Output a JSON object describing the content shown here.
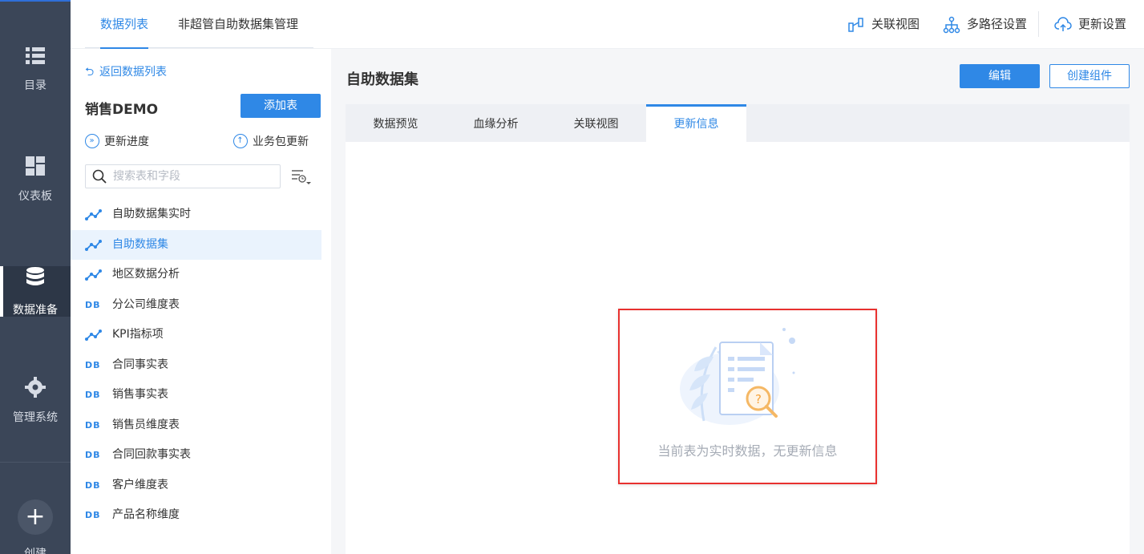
{
  "leftnav": {
    "items": [
      {
        "label": "目录",
        "icon": "list-icon"
      },
      {
        "label": "仪表板",
        "icon": "dashboard-icon"
      },
      {
        "label": "数据准备",
        "icon": "database-icon",
        "active": true
      },
      {
        "label": "管理系统",
        "icon": "gear-icon"
      }
    ],
    "create_label": "创建",
    "create_symbol": "+"
  },
  "topbar": {
    "tabs": [
      {
        "label": "数据列表",
        "active": true
      },
      {
        "label": "非超管自助数据集管理",
        "active": false
      }
    ],
    "actions": [
      {
        "label": "关联视图",
        "icon": "relation-view-icon"
      },
      {
        "label": "多路径设置",
        "icon": "multipath-icon"
      },
      {
        "label": "更新设置",
        "icon": "cloud-update-icon"
      }
    ]
  },
  "panel": {
    "back_label": "返回数据列表",
    "package_title": "销售DEMO",
    "add_table_label": "添加表",
    "progress_label": "更新进度",
    "package_update_label": "业务包更新",
    "search_placeholder": "搜索表和字段",
    "tables": [
      {
        "label": "自助数据集实时",
        "type": "selfhelp"
      },
      {
        "label": "自助数据集",
        "type": "selfhelp",
        "selected": true
      },
      {
        "label": "地区数据分析",
        "type": "selfhelp"
      },
      {
        "label": "分公司维度表",
        "type": "db"
      },
      {
        "label": "KPI指标项",
        "type": "selfhelp"
      },
      {
        "label": "合同事实表",
        "type": "db"
      },
      {
        "label": "销售事实表",
        "type": "db"
      },
      {
        "label": "销售员维度表",
        "type": "db"
      },
      {
        "label": "合同回款事实表",
        "type": "db"
      },
      {
        "label": "客户维度表",
        "type": "db"
      },
      {
        "label": "产品名称维度",
        "type": "db"
      }
    ],
    "db_icon_text": "DB"
  },
  "main": {
    "title": "自助数据集",
    "edit_label": "编辑",
    "create_component_label": "创建组件",
    "tabs": [
      {
        "label": "数据预览"
      },
      {
        "label": "血缘分析"
      },
      {
        "label": "关联视图"
      },
      {
        "label": "更新信息",
        "active": true
      }
    ],
    "empty_message": "当前表为实时数据，无更新信息"
  },
  "colors": {
    "accent": "#2f88e6",
    "nav_bg": "#3b4658",
    "highlight_border": "#e8312f"
  }
}
